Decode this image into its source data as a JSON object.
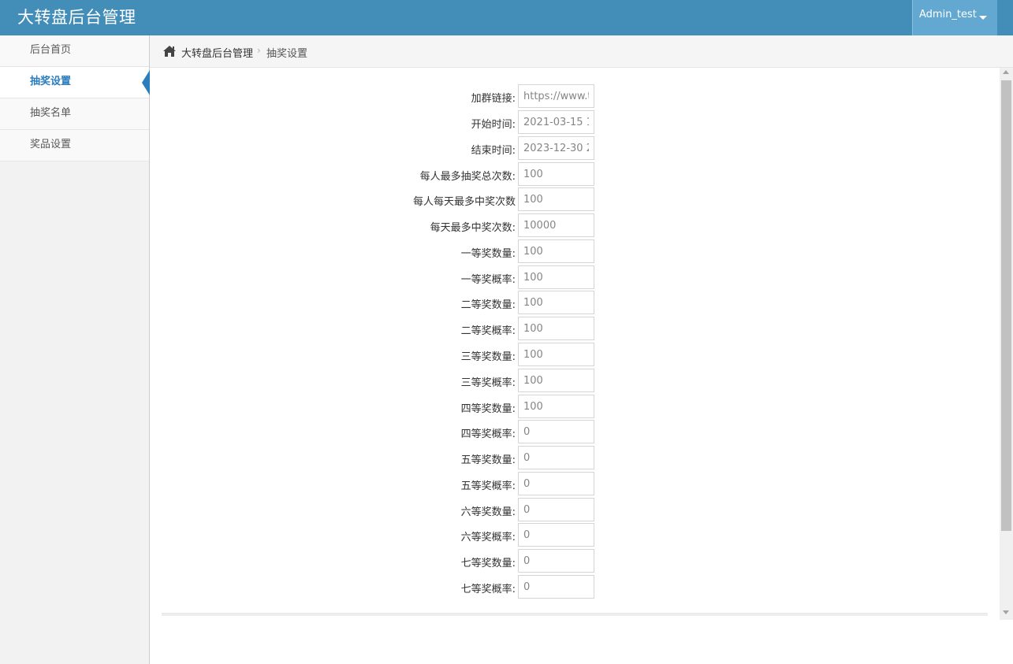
{
  "header": {
    "brand": "大转盘后台管理",
    "user": "Admin_test",
    "brand_color": "#438eb9",
    "user_menu_color": "#62a8d1"
  },
  "sidebar": {
    "items": [
      {
        "label": "后台首页",
        "active": false
      },
      {
        "label": "抽奖设置",
        "active": true
      },
      {
        "label": "抽奖名单",
        "active": false
      },
      {
        "label": "奖品设置",
        "active": false
      }
    ],
    "accent_color": "#2b7dbc"
  },
  "breadcrumb": {
    "home_icon": "home-icon",
    "home": "大转盘后台管理",
    "separator": "›",
    "current": "抽奖设置"
  },
  "form": {
    "fields": [
      {
        "label": "加群链接:",
        "value": "https://www.t"
      },
      {
        "label": "开始时间:",
        "value": "2021-03-15 1("
      },
      {
        "label": "结束时间:",
        "value": "2023-12-30 2:"
      },
      {
        "label": "每人最多抽奖总次数:",
        "value": "100"
      },
      {
        "label": "每人每天最多中奖次数",
        "value": "100"
      },
      {
        "label": "每天最多中奖次数:",
        "value": "10000"
      },
      {
        "label": "一等奖数量:",
        "value": "100"
      },
      {
        "label": "一等奖概率:",
        "value": "100"
      },
      {
        "label": "二等奖数量:",
        "value": "100"
      },
      {
        "label": "二等奖概率:",
        "value": "100"
      },
      {
        "label": "三等奖数量:",
        "value": "100"
      },
      {
        "label": "三等奖概率:",
        "value": "100"
      },
      {
        "label": "四等奖数量:",
        "value": "100"
      },
      {
        "label": "四等奖概率:",
        "value": "0"
      },
      {
        "label": "五等奖数量:",
        "value": "0"
      },
      {
        "label": "五等奖概率:",
        "value": "0"
      },
      {
        "label": "六等奖数量:",
        "value": "0"
      },
      {
        "label": "六等奖概率:",
        "value": "0"
      },
      {
        "label": "七等奖数量:",
        "value": "0"
      },
      {
        "label": "七等奖概率:",
        "value": "0"
      }
    ]
  }
}
